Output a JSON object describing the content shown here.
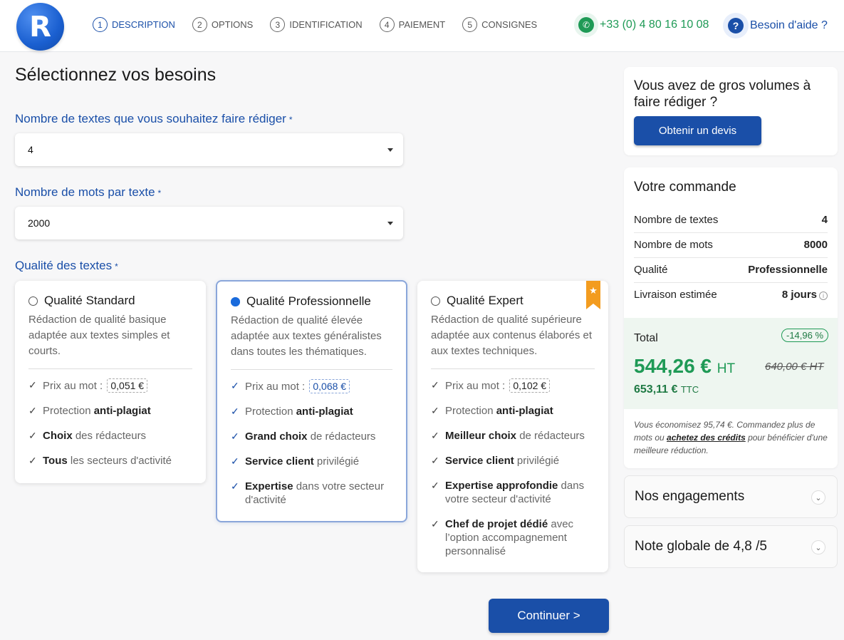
{
  "header": {
    "logo_letter": "R",
    "steps": [
      {
        "num": "1",
        "label": "DESCRIPTION"
      },
      {
        "num": "2",
        "label": "OPTIONS"
      },
      {
        "num": "3",
        "label": "IDENTIFICATION"
      },
      {
        "num": "4",
        "label": "PAIEMENT"
      },
      {
        "num": "5",
        "label": "CONSIGNES"
      }
    ],
    "phone": "+33 (0) 4 80 16 10 08",
    "help": "Besoin d'aide ?",
    "help_icon": "?"
  },
  "main": {
    "title": "Sélectionnez vos besoins",
    "required_mark": "*",
    "texts_label": "Nombre de textes que vous souhaitez faire rédiger",
    "texts_value": "4",
    "words_label": "Nombre de mots par texte",
    "words_value": "2000",
    "quality_label": "Qualité des textes",
    "cards": [
      {
        "title": "Qualité Standard",
        "desc": "Rédaction de qualité basique adaptée aux textes simples et courts.",
        "price_label": "Prix au mot :",
        "price": "0,051 €",
        "f2_pre": "Protection ",
        "f2_b": "anti-plagiat",
        "f2_post": "",
        "f3_b": "Choix",
        "f3_post": " des rédacteurs",
        "f4_b": "Tous",
        "f4_post": " les secteurs d'activité"
      },
      {
        "title": "Qualité Professionnelle",
        "desc": "Rédaction de qualité élevée adaptée aux textes généralistes dans toutes les thématiques.",
        "price_label": "Prix au mot :",
        "price": "0,068 €",
        "f2_pre": "Protection ",
        "f2_b": "anti-plagiat",
        "f3_b": "Grand choix",
        "f3_post": " de rédacteurs",
        "f4_b": "Service client",
        "f4_post": " privilégié",
        "f5_b": "Expertise",
        "f5_post": " dans votre secteur d'activité"
      },
      {
        "title": "Qualité Expert",
        "desc": "Rédaction de qualité supérieure adaptée aux contenus élaborés et aux textes techniques.",
        "price_label": "Prix au mot :",
        "price": "0,102 €",
        "f2_pre": "Protection ",
        "f2_b": "anti-plagiat",
        "f3_b": "Meilleur choix",
        "f3_post": " de rédacteurs",
        "f4_b": "Service client",
        "f4_post": " privilégié",
        "f5_b": "Expertise approfondie",
        "f5_post": " dans votre secteur d'activité",
        "f6_b": "Chef de projet dédié",
        "f6_post": " avec l’option accompagnement personnalisé"
      }
    ],
    "check": "✓",
    "star": "★",
    "continue": "Continuer >"
  },
  "sidebar": {
    "quote_title": "Vous avez de gros volumes à faire rédiger ?",
    "quote_button": "Obtenir un devis",
    "order_title": "Votre commande",
    "rows": [
      {
        "label": "Nombre de textes",
        "value": "4"
      },
      {
        "label": "Nombre de mots",
        "value": "8000"
      },
      {
        "label": "Qualité",
        "value": "Professionnelle"
      },
      {
        "label": "Livraison estimée",
        "value": "8 jours"
      }
    ],
    "total_label": "Total",
    "discount": "-14,96 %",
    "ht_value": "544,26 €",
    "ht_suffix": "HT",
    "old_price": "640,00 € HT",
    "ttc_value": "653,11 €",
    "ttc_suffix": "TTC",
    "savings_pre": "Vous économisez 95,74 €. Commandez plus de mots ou ",
    "savings_link": "achetez des crédits",
    "savings_post": " pour bénéficier d'une meilleure réduction.",
    "engagements": "Nos engagements",
    "rating": "Note globale de 4,8 /5",
    "chevron": "⌄"
  },
  "colors": {
    "primary": "#1a4fa8",
    "green": "#1f9a56",
    "orange": "#f39c1f"
  }
}
